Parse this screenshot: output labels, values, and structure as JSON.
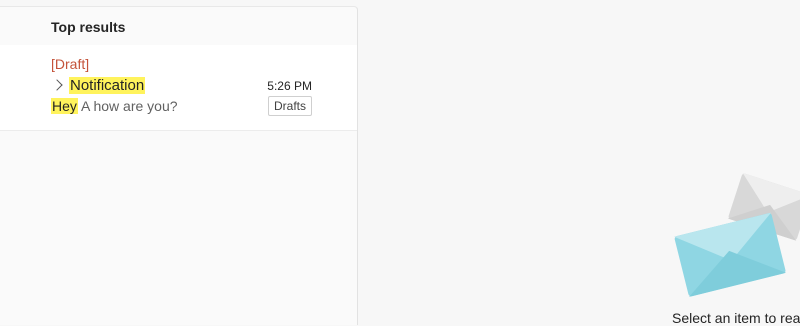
{
  "list": {
    "section_title": "Top results",
    "results": [
      {
        "tag": "[Draft]",
        "subject": "Notification",
        "time": "5:26 PM",
        "preview_highlight": "Hey",
        "preview_rest": " A how are you?",
        "folder": "Drafts"
      }
    ]
  },
  "reading_pane": {
    "placeholder_text": "Select an item to read"
  },
  "colors": {
    "highlight": "#fff35c",
    "draft_tag": "#c4533a",
    "envelope_front": "#8fd6e3",
    "envelope_back": "#d9d9d9"
  },
  "icons": {
    "expand": "chevron-right-icon",
    "illustration": "envelopes-illustration"
  }
}
